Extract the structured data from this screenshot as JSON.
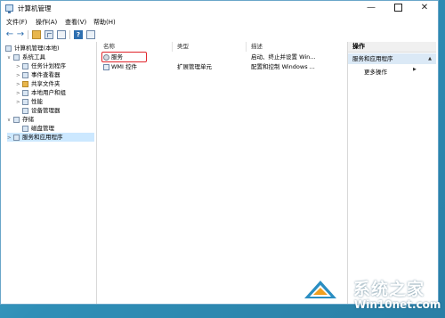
{
  "window": {
    "title": "计算机管理"
  },
  "menu": [
    "文件(F)",
    "操作(A)",
    "查看(V)",
    "帮助(H)"
  ],
  "tree": [
    {
      "label": "计算机管理(本地)",
      "indent": 0,
      "arrow": ""
    },
    {
      "label": "系统工具",
      "indent": 1,
      "arrow": "∨"
    },
    {
      "label": "任务计划程序",
      "indent": 2,
      "arrow": ">"
    },
    {
      "label": "事件查看器",
      "indent": 2,
      "arrow": ">"
    },
    {
      "label": "共享文件夹",
      "indent": 2,
      "arrow": ">"
    },
    {
      "label": "本地用户和组",
      "indent": 2,
      "arrow": ">"
    },
    {
      "label": "性能",
      "indent": 2,
      "arrow": ">"
    },
    {
      "label": "设备管理器",
      "indent": 2,
      "arrow": ""
    },
    {
      "label": "存储",
      "indent": 1,
      "arrow": "∨"
    },
    {
      "label": "磁盘管理",
      "indent": 2,
      "arrow": ""
    },
    {
      "label": "服务和应用程序",
      "indent": 1,
      "arrow": ">"
    }
  ],
  "list": {
    "columns": [
      "名称",
      "类型",
      "描述"
    ],
    "rows": [
      {
        "name": "服务",
        "type": "",
        "desc": "启动、终止并设置 Win..."
      },
      {
        "name": "WMI 控件",
        "type": "扩展管理单元",
        "desc": "配置和控制 Windows ..."
      }
    ]
  },
  "actions": {
    "header": "操作",
    "section": "服务和应用程序",
    "more": "更多操作"
  },
  "watermark": {
    "cn": "系统之家",
    "en": "Win10net.com"
  },
  "colors": {
    "accent": "#0078d7",
    "highlight": "#e0242a",
    "selection": "#cce8ff"
  }
}
